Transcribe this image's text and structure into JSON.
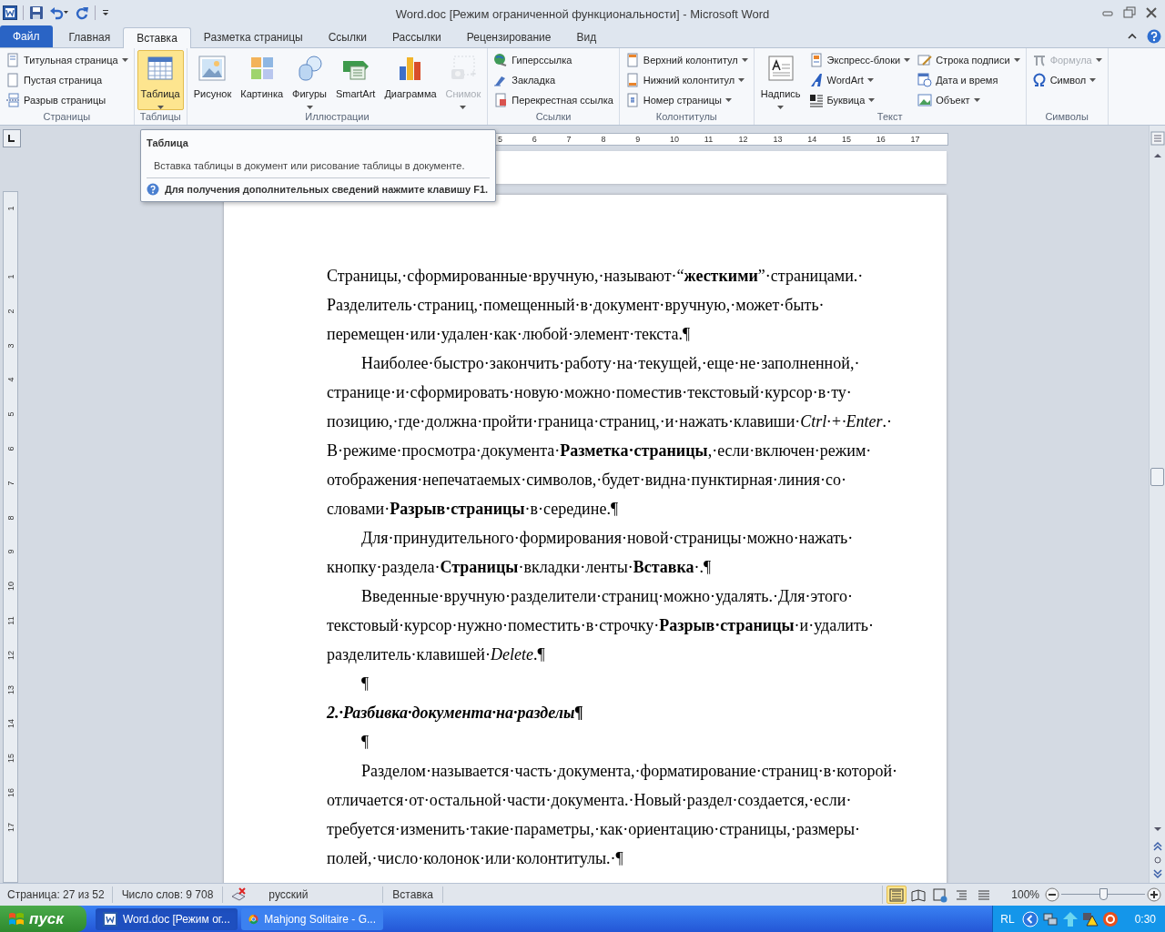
{
  "window": {
    "title": "Word.doc [Режим ограниченной функциональности] - Microsoft Word"
  },
  "tabs": [
    {
      "label": "Файл",
      "kind": "file",
      "selected": false
    },
    {
      "label": "Главная",
      "kind": "tab",
      "selected": false
    },
    {
      "label": "Вставка",
      "kind": "tab",
      "selected": true
    },
    {
      "label": "Разметка страницы",
      "kind": "tab",
      "selected": false
    },
    {
      "label": "Ссылки",
      "kind": "tab",
      "selected": false
    },
    {
      "label": "Рассылки",
      "kind": "tab",
      "selected": false
    },
    {
      "label": "Рецензирование",
      "kind": "tab",
      "selected": false
    },
    {
      "label": "Вид",
      "kind": "tab",
      "selected": false
    }
  ],
  "ribbon": {
    "groups": [
      {
        "label": "Страницы",
        "items": [
          {
            "label": "Титульная страница",
            "kind": "small",
            "dropdown": true,
            "disabled": false,
            "selected": false
          },
          {
            "label": "Пустая страница",
            "kind": "small",
            "dropdown": false,
            "disabled": false,
            "selected": false
          },
          {
            "label": "Разрыв страницы",
            "kind": "small",
            "dropdown": false,
            "disabled": false,
            "selected": false
          }
        ]
      },
      {
        "label": "Таблицы",
        "items": [
          {
            "label": "Таблица",
            "kind": "large",
            "dropdown": true,
            "disabled": false,
            "selected": true
          }
        ]
      },
      {
        "label": "Иллюстрации",
        "items": [
          {
            "label": "Рисунок",
            "kind": "large",
            "dropdown": false,
            "disabled": false,
            "selected": false
          },
          {
            "label": "Картинка",
            "kind": "large",
            "dropdown": false,
            "disabled": false,
            "selected": false
          },
          {
            "label": "Фигуры",
            "kind": "large",
            "dropdown": true,
            "disabled": false,
            "selected": false
          },
          {
            "label": "SmartArt",
            "kind": "large",
            "dropdown": false,
            "disabled": false,
            "selected": false
          },
          {
            "label": "Диаграмма",
            "kind": "large",
            "dropdown": false,
            "disabled": false,
            "selected": false
          },
          {
            "label": "Снимок",
            "kind": "large",
            "dropdown": true,
            "disabled": true,
            "selected": false
          }
        ]
      },
      {
        "label": "Ссылки",
        "items": [
          {
            "label": "Гиперссылка",
            "kind": "small",
            "dropdown": false,
            "disabled": false,
            "selected": false
          },
          {
            "label": "Закладка",
            "kind": "small",
            "dropdown": false,
            "disabled": false,
            "selected": false
          },
          {
            "label": "Перекрестная ссылка",
            "kind": "small",
            "dropdown": false,
            "disabled": false,
            "selected": false
          }
        ]
      },
      {
        "label": "Колонтитулы",
        "items": [
          {
            "label": "Верхний колонтитул",
            "kind": "small",
            "dropdown": true,
            "disabled": false,
            "selected": false
          },
          {
            "label": "Нижний колонтитул",
            "kind": "small",
            "dropdown": true,
            "disabled": false,
            "selected": false
          },
          {
            "label": "Номер страницы",
            "kind": "small",
            "dropdown": true,
            "disabled": false,
            "selected": false
          }
        ]
      },
      {
        "label": "Текст",
        "items": [
          {
            "label": "Надпись",
            "kind": "large",
            "dropdown": true,
            "disabled": false,
            "selected": false
          },
          {
            "label": "Экспресс-блоки",
            "kind": "small",
            "dropdown": true,
            "disabled": false,
            "selected": false
          },
          {
            "label": "WordArt",
            "kind": "small",
            "dropdown": true,
            "disabled": false,
            "selected": false
          },
          {
            "label": "Буквица",
            "kind": "small",
            "dropdown": true,
            "disabled": false,
            "selected": false
          },
          {
            "label": "Строка подписи",
            "kind": "small",
            "dropdown": true,
            "disabled": false,
            "selected": false
          },
          {
            "label": "Дата и время",
            "kind": "small",
            "dropdown": false,
            "disabled": false,
            "selected": false
          },
          {
            "label": "Объект",
            "kind": "small",
            "dropdown": true,
            "disabled": false,
            "selected": false
          }
        ]
      },
      {
        "label": "Символы",
        "items": [
          {
            "label": "Формула",
            "kind": "small",
            "dropdown": true,
            "disabled": true,
            "selected": false
          },
          {
            "label": "Символ",
            "kind": "small",
            "dropdown": true,
            "disabled": false,
            "selected": false
          }
        ]
      }
    ]
  },
  "tooltip": {
    "title": "Таблица",
    "description": "Вставка таблицы в документ или рисование таблицы в документе.",
    "help": "Для получения дополнительных сведений нажмите клавишу F1."
  },
  "ruler": {
    "horizontal": [
      "5",
      "6",
      "7",
      "8",
      "9",
      "10",
      "11",
      "12",
      "13",
      "14",
      "15",
      "16",
      "17"
    ],
    "vertical": [
      "1",
      "1",
      "2",
      "3",
      "4",
      "5",
      "6",
      "7",
      "8",
      "9",
      "10",
      "11",
      "12",
      "13",
      "14",
      "15",
      "16",
      "17"
    ]
  },
  "document": {
    "paragraphs": [
      {
        "kind": "body",
        "indent": false,
        "text": "Страницы,·сформированные·вручную,·называют·“**жесткими**”·страницами.·Разделитель·страниц,·помещенный·в·документ·вручную,·может·быть·перемещен·или·удален·как·любой·элемент·текста.¶"
      },
      {
        "kind": "body",
        "indent": true,
        "text": "Наиболее·быстро·закончить·работу·на·текущей,·еще·не·заполненной,·странице·и·сформировать·новую·можно·поместив·текстовый·курсор·в·ту·позицию,·где·должна·пройти·граница·страниц,·и·нажать·клавиши·*Ctrl·+·Enter*.·В·режиме·просмотра·документа·**Разметка·страницы**,·если·включен·режим·отображения·непечатаемых·символов,·будет·видна·пунктирная·линия·со·словами·**Разрыв·страницы**·в·середине.¶"
      },
      {
        "kind": "body",
        "indent": true,
        "text": "Для·принудительного·формирования·новой·страницы·можно·нажать·кнопку·раздела·**Страницы**·вкладки·ленты·**Вставка**·.¶"
      },
      {
        "kind": "body",
        "indent": true,
        "text": "Введенные·вручную·разделители·страниц·можно·удалять.·Для·этого·текстовый·курсор·нужно·поместить·в·строчку·**Разрыв·страницы**·и·удалить·разделитель·клавишей·*Delete*.¶"
      },
      {
        "kind": "body",
        "indent": true,
        "text": "¶"
      },
      {
        "kind": "heading",
        "indent": false,
        "text": "2.·Разбивка·документа·на·разделы¶"
      },
      {
        "kind": "body",
        "indent": true,
        "text": "¶"
      },
      {
        "kind": "body",
        "indent": true,
        "text": "Разделом·называется·часть·документа,·форматирование·страниц·в·которой·отличается·от·остальной·части·документа.·Новый·раздел·создается,·если·требуется·изменить·такие·параметры,·как·ориентацию·страницы,·размеры·полей,·число·колонок·или·колонтитулы.·¶"
      }
    ]
  },
  "status_bar": {
    "page": "Страница: 27 из 52",
    "words": "Число слов: 9 708",
    "language": "русский",
    "mode": "Вставка",
    "views": [
      {
        "selected": true
      },
      {
        "selected": false
      },
      {
        "selected": false
      },
      {
        "selected": false
      },
      {
        "selected": false
      }
    ],
    "zoom": "100%",
    "zoom_slider": {
      "level": 0.5
    }
  },
  "taskbar": {
    "start": "пуск",
    "items": [
      {
        "label": "Word.doc [Режим ог...",
        "kind": "word",
        "selected": true
      },
      {
        "label": "Mahjong Solitaire - G...",
        "kind": "browser",
        "selected": false
      }
    ],
    "tray_language": "RL",
    "time": "0:30"
  }
}
